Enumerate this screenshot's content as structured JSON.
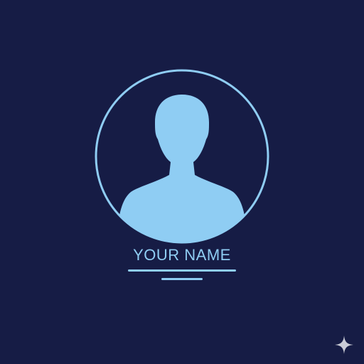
{
  "profile": {
    "name_label": "YOUR NAME",
    "avatar_icon": "person-silhouette-icon"
  },
  "corner_icon": "sparkle-icon",
  "colors": {
    "background": "#161c45",
    "accent": "#8fcdf3",
    "sparkle": "#c9cbd6"
  }
}
